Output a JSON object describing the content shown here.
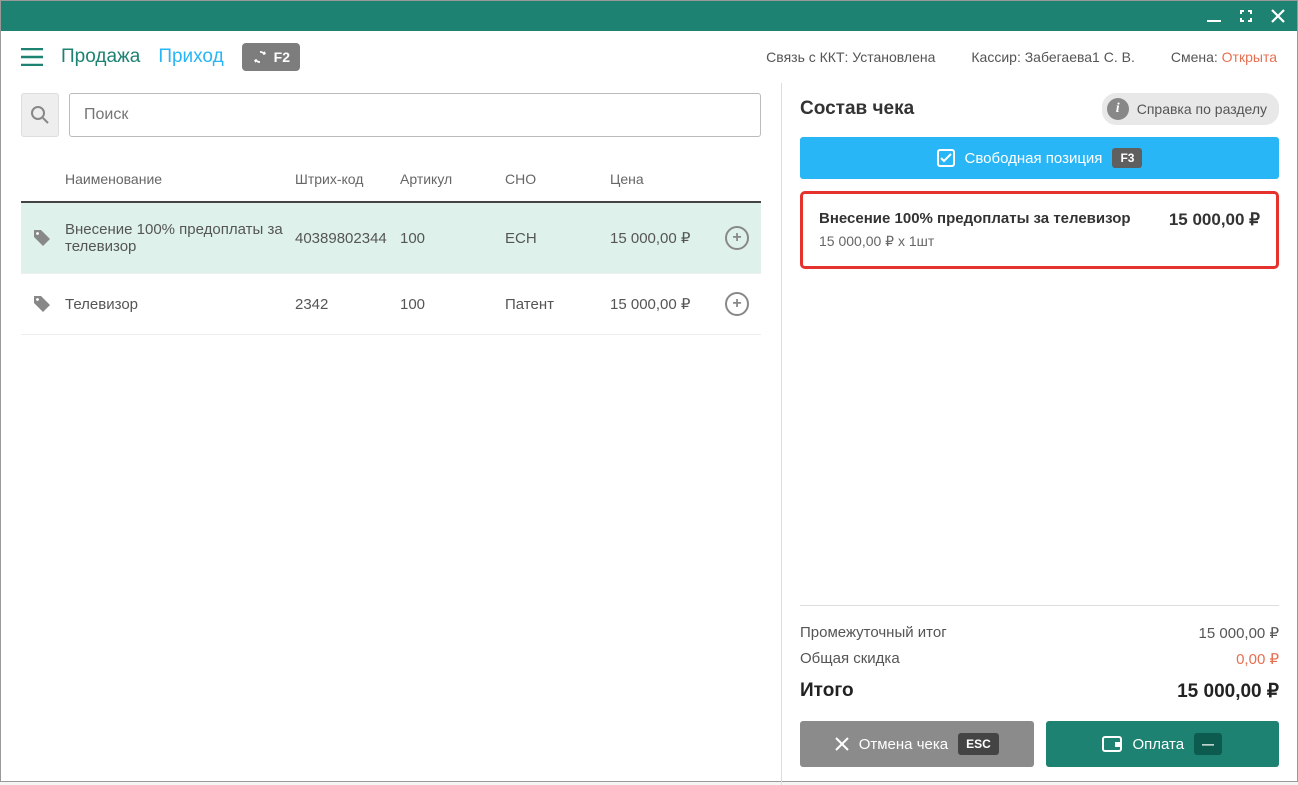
{
  "header": {
    "tab_sale": "Продажа",
    "tab_income": "Приход",
    "f2_key": "F2",
    "kkt_label": "Связь с ККТ:",
    "kkt_status": "Установлена",
    "cashier_label": "Кассир:",
    "cashier_name": "Забегаева1 С. В.",
    "shift_label": "Смена:",
    "shift_status": "Открыта"
  },
  "search": {
    "placeholder": "Поиск"
  },
  "table": {
    "headers": {
      "name": "Наименование",
      "barcode": "Штрих-код",
      "article": "Артикул",
      "sno": "СНО",
      "price": "Цена"
    },
    "rows": [
      {
        "name": "Внесение 100% предоплаты за телевизор",
        "barcode": "40389802344",
        "article": "100",
        "sno": "ЕСН",
        "price": "15 000,00 ₽",
        "selected": true
      },
      {
        "name": "Телевизор",
        "barcode": "2342",
        "article": "100",
        "sno": "Патент",
        "price": "15 000,00 ₽",
        "selected": false
      }
    ]
  },
  "receipt": {
    "title": "Состав чека",
    "help_label": "Справка по разделу",
    "free_position_label": "Свободная позиция",
    "free_position_key": "F3",
    "items": [
      {
        "name": "Внесение 100% предоплаты за телевизор",
        "sub": "15 000,00 ₽ x 1шт",
        "price": "15 000,00 ₽"
      }
    ],
    "subtotal_label": "Промежуточный итог",
    "subtotal_value": "15 000,00 ₽",
    "discount_label": "Общая скидка",
    "discount_value": "0,00 ₽",
    "total_label": "Итого",
    "total_value": "15 000,00 ₽",
    "cancel_label": "Отмена чека",
    "cancel_key": "ESC",
    "pay_label": "Оплата",
    "pay_key": "—"
  }
}
